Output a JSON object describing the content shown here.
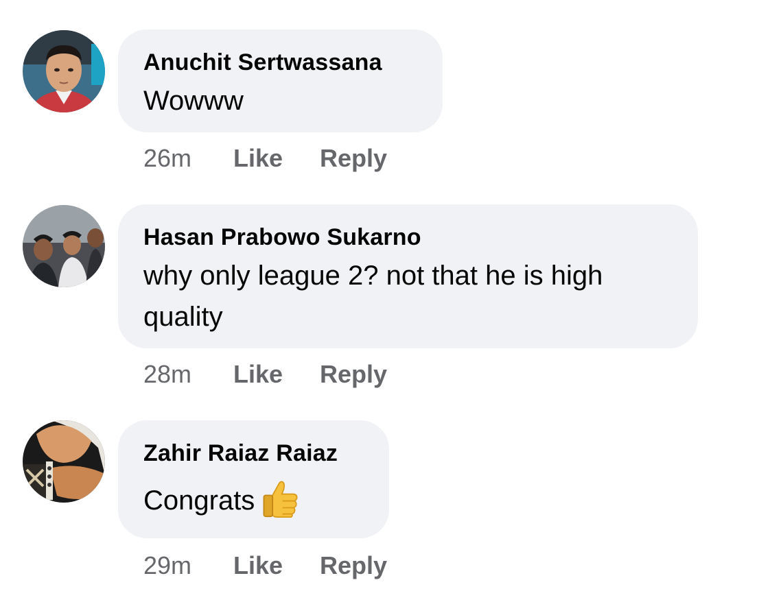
{
  "comments": [
    {
      "author": "Anuchit Sertwassana",
      "text": "Wowww",
      "time": "26m",
      "like_label": "Like",
      "reply_label": "Reply",
      "avatar": "profile-photo"
    },
    {
      "author": "Hasan Prabowo Sukarno",
      "text_line1": "why only league 2? not that he is high",
      "text_line2": "quality",
      "time": "28m",
      "like_label": "Like",
      "reply_label": "Reply",
      "avatar": "group-photo"
    },
    {
      "author": "Zahir Raiaz Raiaz",
      "text": "Congrats",
      "emoji": "thumbs-up",
      "time": "29m",
      "like_label": "Like",
      "reply_label": "Reply",
      "avatar": "profile-photo"
    }
  ],
  "colors": {
    "bubble": "#f0f2f5",
    "meta_text": "#65676b",
    "primary_text": "#050505"
  }
}
